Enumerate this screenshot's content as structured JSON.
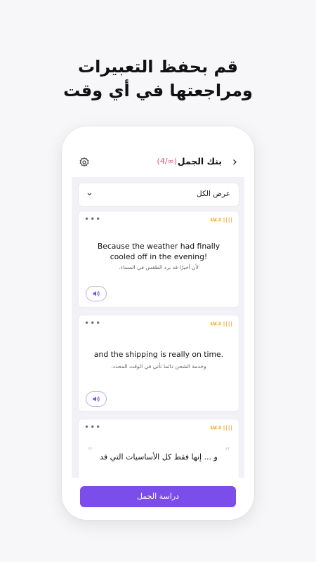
{
  "promo": {
    "line1": "قم بحفظ التعبيرات",
    "line2": "ومراجعتها في أي وقت"
  },
  "header": {
    "title": "بنك الجمل",
    "count": "(4/∞)",
    "back_icon": "chevron-right-icon",
    "settings_icon": "gear-icon"
  },
  "filter": {
    "label": "عرض الكل",
    "icon": "chevron-down-icon"
  },
  "cards": [
    {
      "level": "LV.1",
      "english": "Because the weather had finally cooled off in the evening!",
      "arabic": "لأن أخيرًا قد برد الطقس في المساء."
    },
    {
      "level": "LV.1",
      "english": "and the shipping is really on time.",
      "arabic": "وخدمة الشحن دائما تأتي في الوقت المحدد."
    },
    {
      "level": "LV.1",
      "arabic_main": "و ... إنها فقط كل الأساسيات التي قد"
    }
  ],
  "bottom": {
    "study_label": "دراسة الجمل"
  },
  "colors": {
    "accent": "#7b4dea",
    "level": "#f29a1c",
    "count": "#e0557a"
  }
}
